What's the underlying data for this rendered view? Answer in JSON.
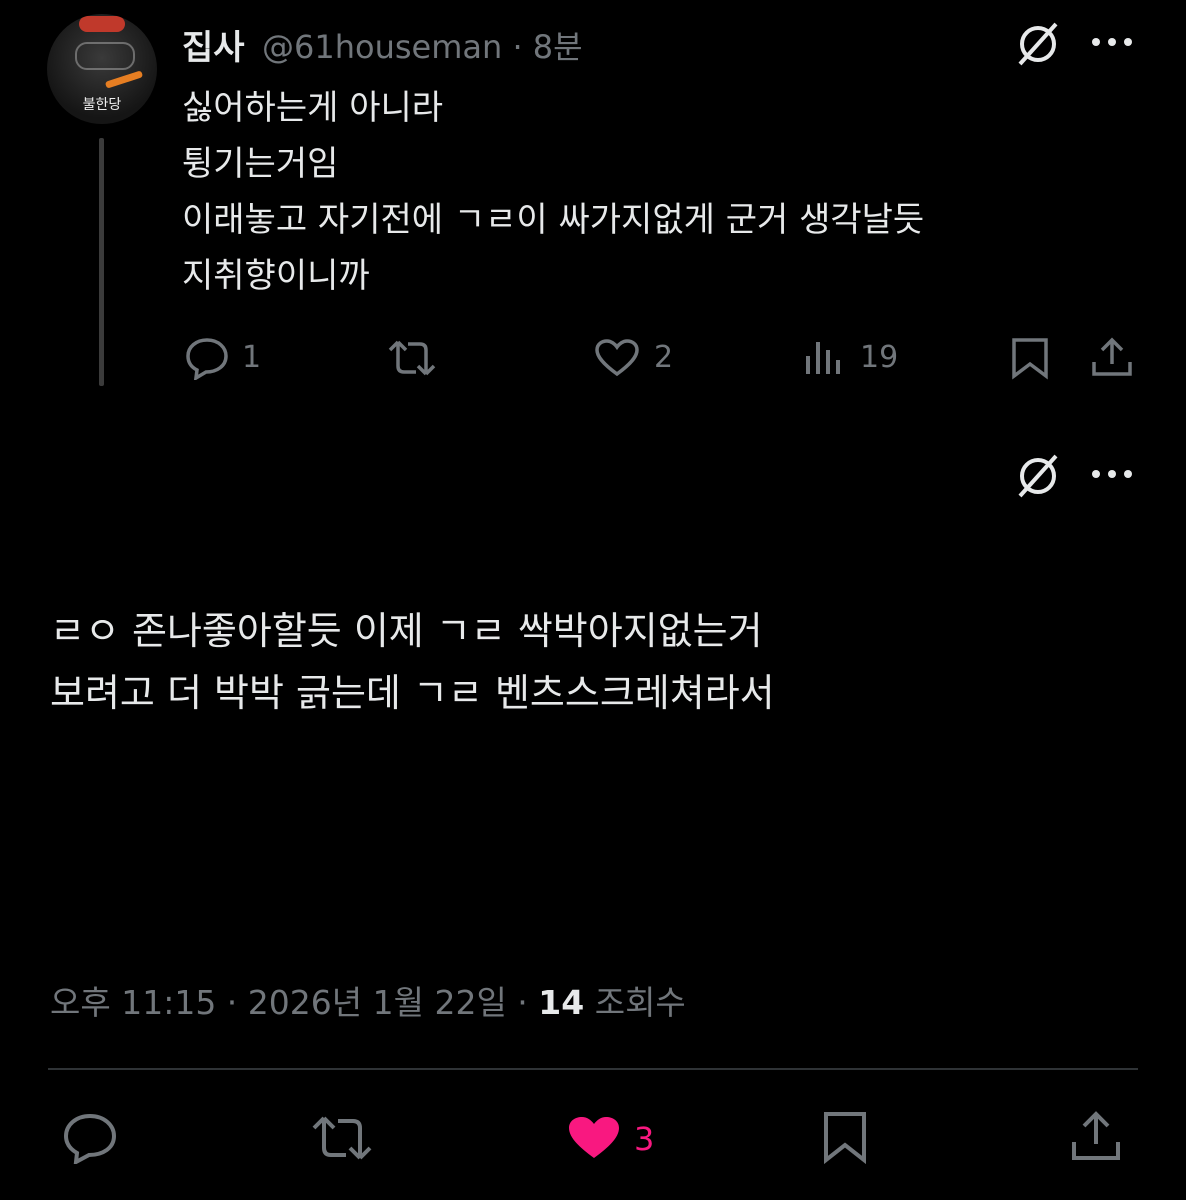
{
  "tweet1": {
    "name": "집사",
    "handle": "@61houseman · 8분",
    "avatar_label": "불한당",
    "lines": [
      "싫어하는게 아니라",
      "튕기는거임",
      "이래놓고 자기전에 ㄱㄹ이 싸가지없게 군거 생각날듯",
      "지취향이니까"
    ],
    "replies": "1",
    "likes": "2",
    "views": "19"
  },
  "tweet2": {
    "lines": [
      "ㄹㅇ 존나좋아할듯 이제 ㄱㄹ 싹박아지없는거",
      "보려고 더 박박 긁는데 ㄱㄹ 벤츠스크레쳐라서"
    ],
    "time": "오후 11:15 · 2026년 1월 22일 · ",
    "views_count": "14",
    "views_label": " 조회수",
    "likes": "3"
  },
  "colors": {
    "background": "#000000",
    "text": "#e7e9ea",
    "muted": "#71767b",
    "like_active": "#f91880"
  },
  "icons": [
    "grok-icon",
    "more-icon",
    "reply-icon",
    "retweet-icon",
    "like-icon",
    "views-icon",
    "bookmark-icon",
    "share-icon"
  ]
}
